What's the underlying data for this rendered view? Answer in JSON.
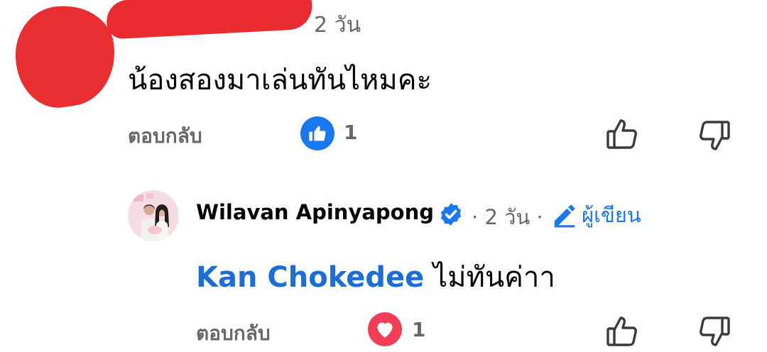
{
  "comments": [
    {
      "author": "",
      "time": "2 วัน",
      "text": "น้องสองมาเล่นทันไหมคะ",
      "reply_label": "ตอบกลับ",
      "reaction": {
        "icon": "like-icon",
        "count": "1",
        "color": "#1877f2"
      }
    },
    {
      "author": "Wilavan Apinyapong",
      "verified": true,
      "separator": "·",
      "time": "2 วัน",
      "author_badge": "ผู้เขียน",
      "mention": "Kan Chokedee",
      "text": "ไม่ทันค่าา",
      "reply_label": "ตอบกลับ",
      "reaction": {
        "icon": "heart-icon",
        "count": "1",
        "color": "#f33e58"
      }
    }
  ],
  "colors": {
    "accent": "#1877f2",
    "muted": "#65676b",
    "redaction": "#e8262a"
  }
}
